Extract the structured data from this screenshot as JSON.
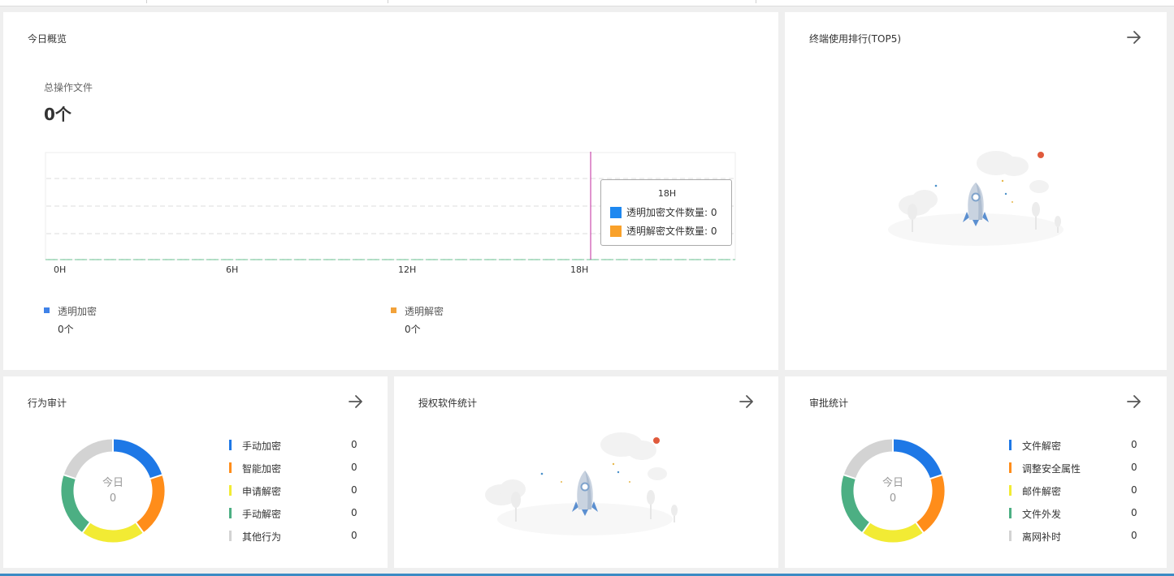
{
  "colors": {
    "blue": "#1e78e6",
    "orange": "#ff8d1a",
    "yellow": "#f2eb34",
    "green": "#4caf83",
    "gray": "#d3d3d3",
    "tt_blue": "#1e88f0",
    "tt_orange": "#f9a12a",
    "accent_line": "#c0279e"
  },
  "overview": {
    "title": "今日概览",
    "total_label": "总操作文件",
    "total_value": "0个",
    "legend": [
      {
        "label": "透明加密",
        "value": "0个",
        "color": "#3f82e8"
      },
      {
        "label": "透明解密",
        "value": "0个",
        "color": "#f2a23a"
      }
    ],
    "tooltip": {
      "title": "18H",
      "rows": [
        {
          "label": "透明加密文件数量: 0",
          "color": "#1e88f0"
        },
        {
          "label": "透明解密文件数量: 0",
          "color": "#f9a12a"
        }
      ]
    }
  },
  "chart_data": {
    "type": "line",
    "x": [
      "0H",
      "6H",
      "12H",
      "18H"
    ],
    "series": [
      {
        "name": "透明加密",
        "values": [
          0,
          0,
          0,
          0
        ]
      },
      {
        "name": "透明解密",
        "values": [
          0,
          0,
          0,
          0
        ]
      }
    ],
    "grid": true,
    "legend": "bottom"
  },
  "terminal_rank": {
    "title": "终端使用排行(TOP5)"
  },
  "behavior_audit": {
    "title": "行为审计",
    "center_label": "今日",
    "center_value": "0",
    "items": [
      {
        "label": "手动加密",
        "count": "0",
        "color": "#1e78e6"
      },
      {
        "label": "智能加密",
        "count": "0",
        "color": "#ff8d1a"
      },
      {
        "label": "申请解密",
        "count": "0",
        "color": "#f2eb34"
      },
      {
        "label": "手动解密",
        "count": "0",
        "color": "#4caf83"
      },
      {
        "label": "其他行为",
        "count": "0",
        "color": "#d3d3d3"
      }
    ]
  },
  "software_stats": {
    "title": "授权软件统计"
  },
  "approval_stats": {
    "title": "审批统计",
    "center_label": "今日",
    "center_value": "0",
    "items": [
      {
        "label": "文件解密",
        "count": "0",
        "color": "#1e78e6"
      },
      {
        "label": "调整安全属性",
        "count": "0",
        "color": "#ff8d1a"
      },
      {
        "label": "邮件解密",
        "count": "0",
        "color": "#f2eb34"
      },
      {
        "label": "文件外发",
        "count": "0",
        "color": "#4caf83"
      },
      {
        "label": "离网补时",
        "count": "0",
        "color": "#d3d3d3"
      }
    ]
  }
}
